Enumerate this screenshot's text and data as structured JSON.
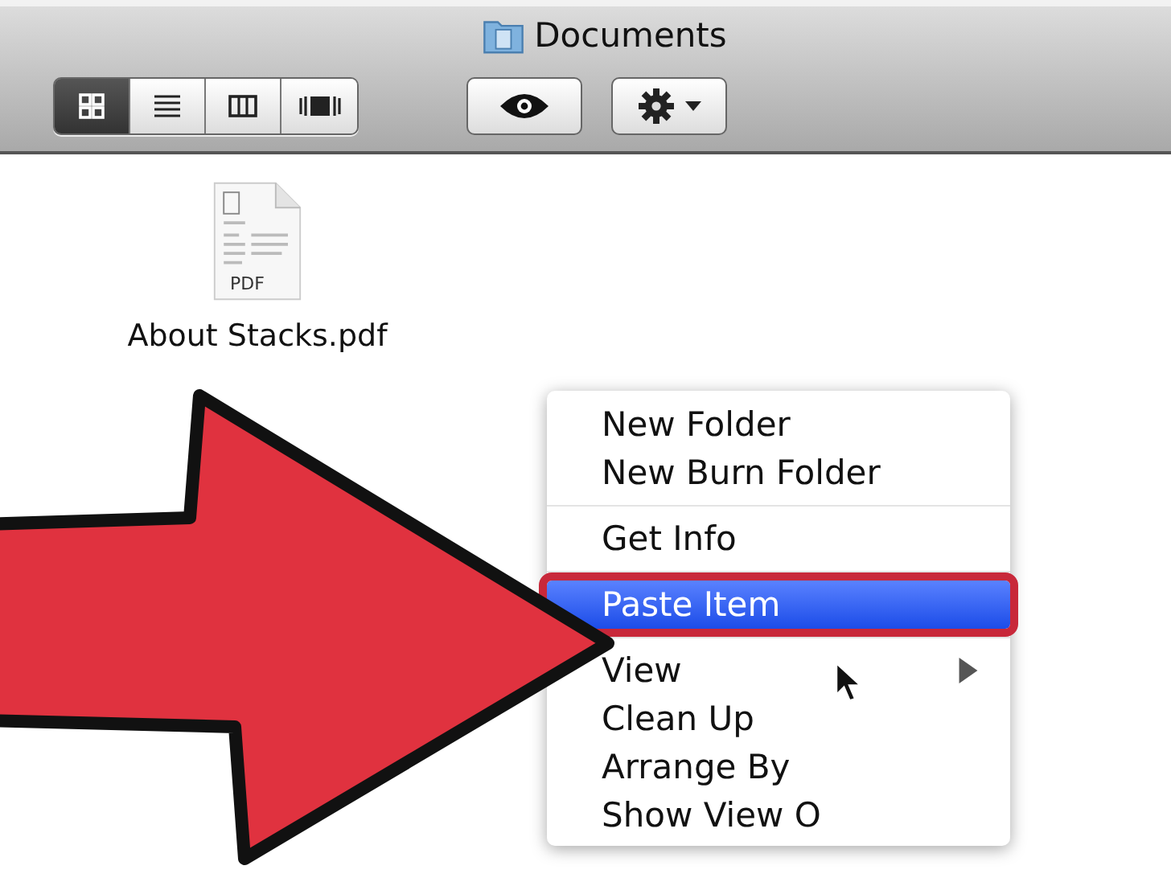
{
  "window": {
    "title": "Documents"
  },
  "toolbar": {
    "view_buttons": [
      {
        "kind": "icon",
        "selected": true
      },
      {
        "kind": "list",
        "selected": false
      },
      {
        "kind": "column",
        "selected": false
      },
      {
        "kind": "coverflow",
        "selected": false
      }
    ]
  },
  "files": [
    {
      "name": "About Stacks.pdf",
      "icon_label": "PDF"
    }
  ],
  "context_menu": {
    "groups": [
      [
        {
          "label": "New Folder",
          "selected": false,
          "submenu": false
        },
        {
          "label": "New Burn Folder",
          "selected": false,
          "submenu": false
        }
      ],
      [
        {
          "label": "Get Info",
          "selected": false,
          "submenu": false
        }
      ],
      [
        {
          "label": "Paste Item",
          "selected": true,
          "submenu": false
        }
      ],
      [
        {
          "label": "View",
          "selected": false,
          "submenu": true
        },
        {
          "label": "Clean Up",
          "selected": false,
          "submenu": false
        },
        {
          "label": "Arrange By",
          "selected": false,
          "submenu": false
        },
        {
          "label": "Show View O",
          "selected": false,
          "submenu": false
        }
      ]
    ]
  }
}
